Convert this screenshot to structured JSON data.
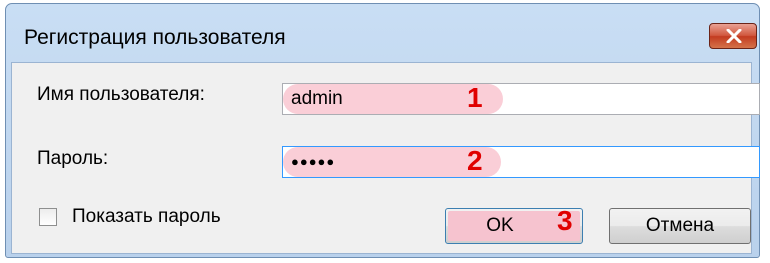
{
  "dialog": {
    "title": "Регистрация пользователя",
    "close_icon": "close-x-icon"
  },
  "form": {
    "username_label": "Имя пользователя:",
    "username_value": "admin",
    "password_label": "Пароль:",
    "password_value": "●●●●●",
    "show_password_label": "Показать пароль",
    "show_password_checked": false
  },
  "buttons": {
    "ok_label": "OK",
    "cancel_label": "Отмена"
  },
  "annotations": {
    "step1": "1",
    "step2": "2",
    "step3": "3",
    "color": "#e00000",
    "highlight_color": "#f9c9d3"
  }
}
